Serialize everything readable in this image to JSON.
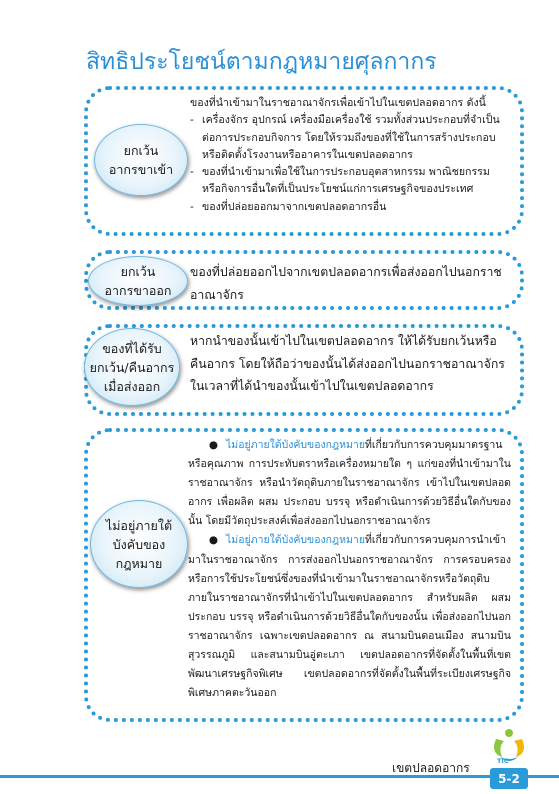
{
  "title": "สิทธิประโยชน์ตามกฎหมายศุลกากร",
  "sections": [
    {
      "label_lines": [
        "ยกเว้น",
        "อากรขาเข้า"
      ],
      "intro": "ของที่นำเข้ามาในราชอาณาจักรเพื่อเข้าไปในเขตปลอดอากร ดังนี้",
      "items": [
        {
          "dash": "-",
          "text": "เครื่องจักร อุปกรณ์ เครื่องมือเครื่องใช้ รวมทั้งส่วนประกอบที่จำเป็นต่อการประกอบกิจการ โดยให้รวมถึงของที่ใช้ในการสร้างประกอบหรือติดตั้งโรงงานหรืออาคารในเขตปลอดอากร"
        },
        {
          "dash": "-",
          "text": "ของที่นำเข้ามาเพื่อใช้ในการประกอบอุตสาหกรรม พาณิชยกรรม หรือกิจการอื่นใดที่เป็นประโยชน์แก่การเศรษฐกิจของประเทศ"
        },
        {
          "dash": "-",
          "text": "ของที่ปล่อยออกมาจากเขตปลอดอากรอื่น"
        }
      ]
    },
    {
      "label_lines": [
        "ยกเว้น",
        "อากรขาออก"
      ],
      "text": "ของที่ปล่อยออกไปจากเขตปลอดอากรเพื่อส่งออกไปนอกราชอาณาจักร"
    },
    {
      "label_lines": [
        "ของที่ได้รับ",
        "ยกเว้น/คืนอากร",
        "เมื่อส่งออก"
      ],
      "text": "หากนำของนั้นเข้าไปในเขตปลอดอากร ให้ได้รับยกเว้นหรือคืนอากร โดยให้ถือว่าของนั้นได้ส่งออกไปนอกราชอาณาจักรในเวลาที่ได้นำของนั้นเข้าไปในเขตปลอดอากร"
    },
    {
      "label_lines": [
        "ไม่อยู่ภายใต้",
        "บังคับของ",
        "กฎหมาย"
      ],
      "paragraphs": [
        {
          "bullet": "●",
          "head": "ไม่อยู่ภายใต้บังคับของกฎหมาย",
          "text": "ที่เกี่ยวกับการควบคุมมาตรฐานหรือคุณภาพ การประทับตราหรือเครื่องหมายใด ๆ แก่ของที่นำเข้ามาในราชอาณาจักร หรือนำวัตถุดิบภายในราชอาณาจักร เข้าไปในเขตปลอดอากร เพื่อผลิต ผสม ประกอบ บรรจุ หรือดำเนินการด้วยวิธีอื่นใดกับของนั้น โดยมีวัตถุประสงค์เพื่อส่งออกไปนอกราชอาณาจักร"
        },
        {
          "bullet": "●",
          "head": "ไม่อยู่ภายใต้บังคับของกฎหมาย",
          "text": "ที่เกี่ยวกับการควบคุมการนำเข้ามาในราชอาณาจักร การส่งออกไปนอกราชอาณาจักร การครอบครองหรือการใช้ประโยชน์ซึ่งของที่นำเข้ามาในราชอาณาจักรหรือวัตถุดิบภายในราชอาณาจักรที่นำเข้าไปในเขตปลอดอากร สำหรับผลิต ผสม ประกอบ บรรจุ หรือดำเนินการด้วยวิธีอื่นใดกับของนั้น เพื่อส่งออกไปนอกราชอาณาจักร เฉพาะเขตปลอดอากร ณ สนามบินดอนเมือง สนามบินสุวรรณภูมิ และสนามบินอู่ตะเภา เขตปลอดอากรที่จัดตั้งในพื้นที่เขตพัฒนาเศรษฐกิจพิเศษ เขตปลอดอากรที่จัดตั้งในพื้นที่ระเบียงเศรษฐกิจพิเศษภาคตะวันออก"
        }
      ]
    }
  ],
  "footer": {
    "label": "เขตปลอดอากร",
    "page": "5-2",
    "logo_text": "TIC"
  },
  "colors": {
    "accent": "#2a9bd8",
    "title": "#2a8fd6"
  }
}
